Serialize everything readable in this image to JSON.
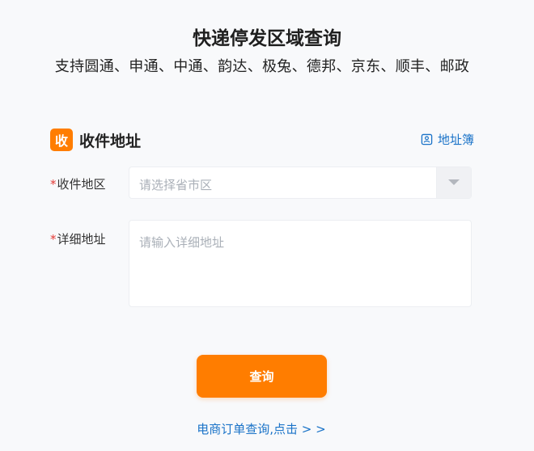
{
  "header": {
    "title": "快递停发区域查询",
    "subtitle": "支持圆通、申通、中通、韵达、极兔、德邦、京东、顺丰、邮政"
  },
  "section": {
    "badge": "收",
    "title": "收件地址",
    "address_book": "地址簿",
    "address_book_icon": "contact-card-icon"
  },
  "form": {
    "required_mark": "*",
    "region_label": "收件地区",
    "region_placeholder": "请选择省市区",
    "detail_label": "详细地址",
    "detail_placeholder": "请输入详细地址"
  },
  "actions": {
    "query_label": "查询",
    "ecommerce_link": "电商订单查询,点击 > >"
  },
  "colors": {
    "accent": "#ff7d00",
    "link": "#1a73c8",
    "required": "#e53935"
  }
}
